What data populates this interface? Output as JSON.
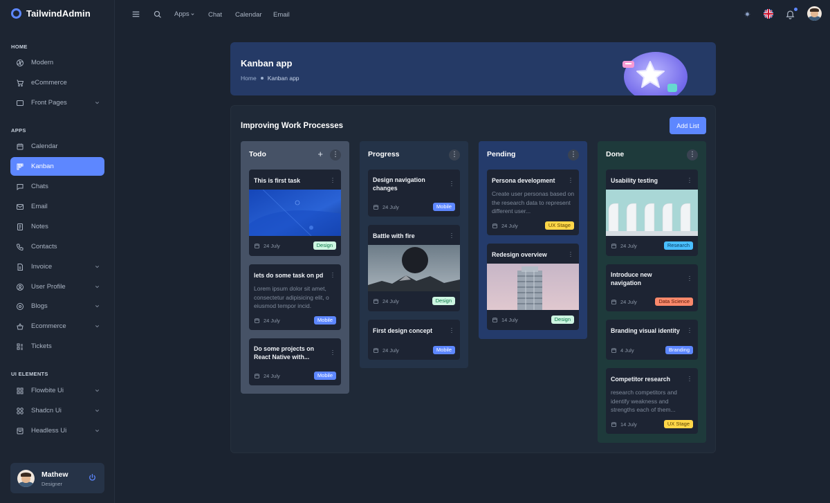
{
  "app": {
    "logo_text": "TailwindAdmin",
    "accent": "#5d87ff"
  },
  "sidebar": {
    "sections": [
      {
        "label": "HOME"
      },
      {
        "label": "APPS"
      },
      {
        "label": "UI ELEMENTS"
      }
    ],
    "items": [
      {
        "label": "Modern",
        "icon": "aperture-icon"
      },
      {
        "label": "eCommerce",
        "icon": "cart-icon"
      },
      {
        "label": "Front Pages",
        "icon": "layout-icon"
      },
      {
        "label": "Calendar",
        "icon": "calendar-icon"
      },
      {
        "label": "Kanban",
        "icon": "kanban-icon",
        "active": true
      },
      {
        "label": "Chats",
        "icon": "message-icon"
      },
      {
        "label": "Email",
        "icon": "mail-icon"
      },
      {
        "label": "Notes",
        "icon": "notes-icon"
      },
      {
        "label": "Contacts",
        "icon": "phone-icon"
      },
      {
        "label": "Invoice",
        "icon": "file-icon"
      },
      {
        "label": "User Profile",
        "icon": "user-circle-icon"
      },
      {
        "label": "Blogs",
        "icon": "chat-circle-icon"
      },
      {
        "label": "Ecommerce",
        "icon": "basket-icon"
      },
      {
        "label": "Tickets",
        "icon": "ticket-icon"
      },
      {
        "label": "Flowbite Ui",
        "icon": "grid-icon"
      },
      {
        "label": "Shadcn Ui",
        "icon": "circles-icon"
      },
      {
        "label": "Headless Ui",
        "icon": "window-icon"
      }
    ],
    "profile": {
      "name": "Mathew",
      "role": "Designer"
    }
  },
  "topbar": {
    "links": [
      "Apps",
      "Chat",
      "Calendar",
      "Email"
    ]
  },
  "banner": {
    "title": "Kanban app",
    "breadcrumb_home": "Home",
    "breadcrumb_current": "Kanban app"
  },
  "board": {
    "title": "Improving Work Processes",
    "add_label": "Add List",
    "columns": [
      {
        "title": "Todo",
        "cards": [
          {
            "title": "This is first task",
            "date": "24 July",
            "badge": "Design"
          },
          {
            "title": "lets do some task on pd",
            "desc": "Lorem ipsum dolor sit amet, consectetur adipisicing elit, o eiusmod tempor incid.",
            "date": "24 July",
            "badge": "Mobile"
          },
          {
            "title": "Do some projects on React Native with...",
            "date": "24 July",
            "badge": "Mobile"
          }
        ]
      },
      {
        "title": "Progress",
        "cards": [
          {
            "title": "Design navigation changes",
            "date": "24 July",
            "badge": "Mobile"
          },
          {
            "title": "Battle with fire",
            "date": "24 July",
            "badge": "Design"
          },
          {
            "title": "First design concept",
            "date": "24 July",
            "badge": "Mobile"
          }
        ]
      },
      {
        "title": "Pending",
        "cards": [
          {
            "title": "Persona development",
            "desc": "Create user personas based on the research data to represent different user...",
            "date": "24 July",
            "badge": "UX Stage"
          },
          {
            "title": "Redesign overview",
            "date": "14 July",
            "badge": "Design"
          }
        ]
      },
      {
        "title": "Done",
        "cards": [
          {
            "title": "Usability testing",
            "date": "24 July",
            "badge": "Research"
          },
          {
            "title": "Introduce new navigation",
            "date": "24 July",
            "badge": "Data Science"
          },
          {
            "title": "Branding visual identity",
            "date": "4 July",
            "badge": "Branding"
          },
          {
            "title": "Competitor research",
            "desc": "research competitors and identify weakness and strengths each of them...",
            "date": "14 July",
            "badge": "UX Stage"
          }
        ]
      }
    ]
  },
  "colors": {
    "badge_design": "#cdf5e1",
    "badge_mobile": "#5d87ff",
    "badge_ux": "#ffd648",
    "badge_research": "#49beff",
    "badge_datascience": "#fa896b",
    "col_todo": "#465266",
    "col_progress": "#243348",
    "col_pending": "#243b6b",
    "col_done": "#1e3a3b"
  }
}
